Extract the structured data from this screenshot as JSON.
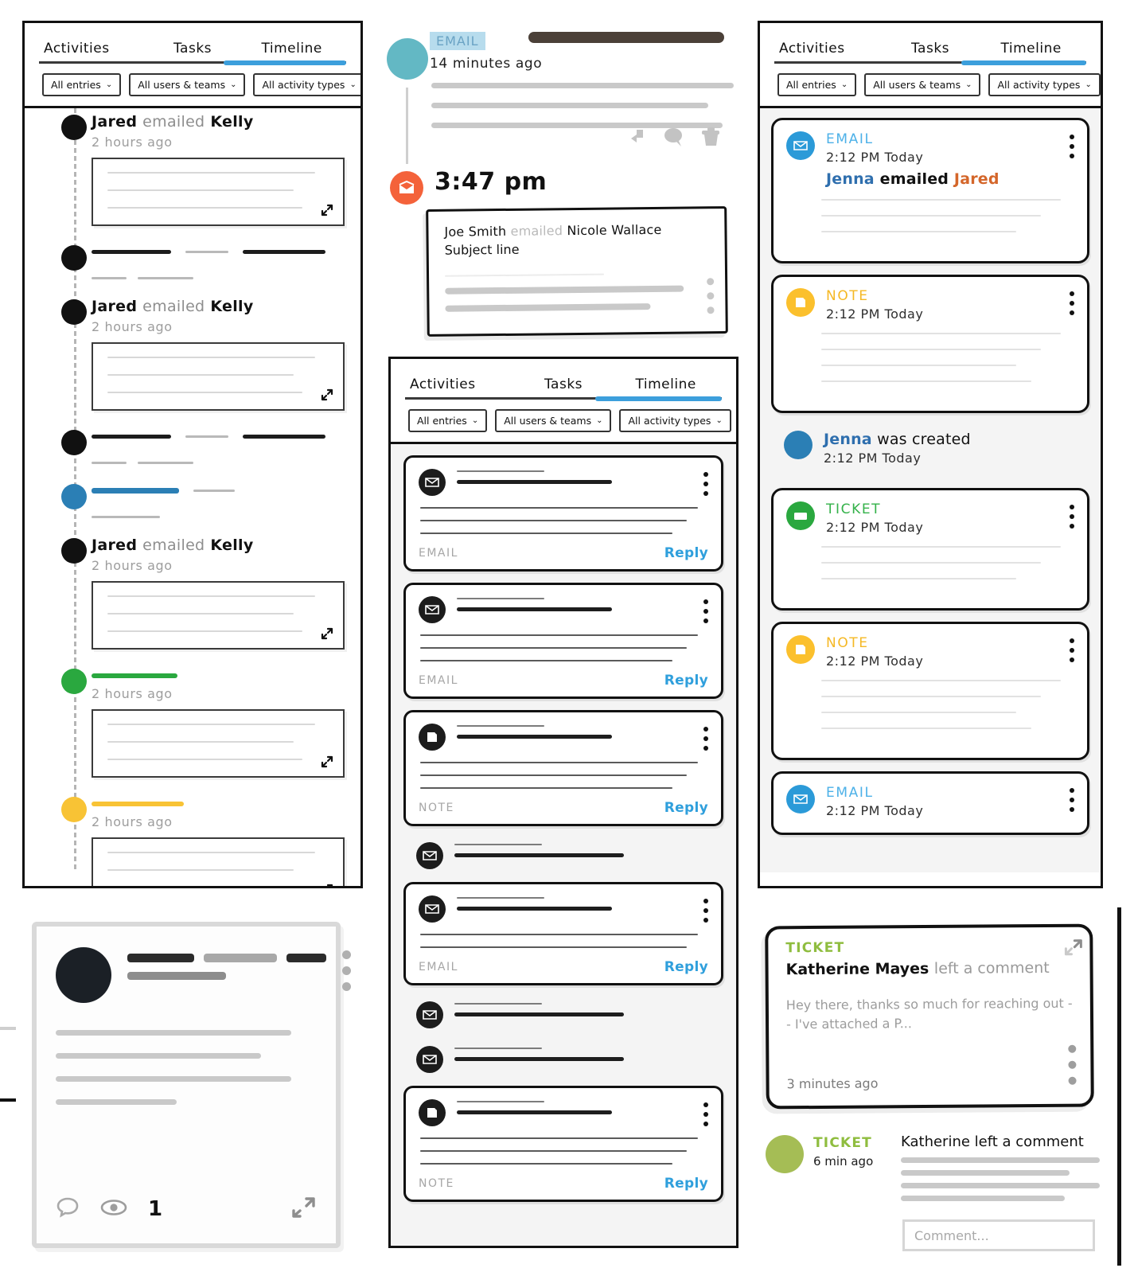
{
  "tabs": {
    "activities": "Activities",
    "tasks": "Tasks",
    "timeline": "Timeline"
  },
  "filters": {
    "entries": "All entries",
    "users": "All users & teams",
    "types": "All activity types",
    "caret": "⌄"
  },
  "left_timeline": {
    "entries": [
      {
        "kind": "titled",
        "dot": "black",
        "actor": "Jared",
        "verb": "emailed",
        "target": "Kelly",
        "time": "2 hours ago",
        "has_panel": true
      },
      {
        "kind": "redacted",
        "dot": "black"
      },
      {
        "kind": "titled",
        "dot": "black",
        "actor": "Jared",
        "verb": "emailed",
        "target": "Kelly",
        "time": "2 hours ago",
        "has_panel": true
      },
      {
        "kind": "redacted",
        "dot": "black"
      },
      {
        "kind": "redacted",
        "dot": "blue"
      },
      {
        "kind": "titled",
        "dot": "black",
        "actor": "Jared",
        "verb": "emailed",
        "target": "Kelly",
        "time": "2 hours ago",
        "has_panel": true
      },
      {
        "kind": "redacted-time",
        "dot": "green",
        "time": "2 hours ago",
        "has_panel": true
      },
      {
        "kind": "redacted-time",
        "dot": "yellow",
        "time": "2 hours ago",
        "has_panel": true
      }
    ]
  },
  "post_card": {
    "view_count": "1",
    "comment_icon": "comment-bubble-icon",
    "views_icon": "eye-icon",
    "expand_icon": "expand-icon"
  },
  "email_detail": {
    "type_label": "EMAIL",
    "time": "14 minutes ago",
    "actions": [
      "reply-arrow-icon",
      "comment-bubble-icon",
      "delete-icon"
    ]
  },
  "time_block": {
    "time": "3:47 pm",
    "avatar_icon": "email-open-icon",
    "card": {
      "actor": "Joe Smith",
      "verb": "emailed",
      "target": "Nicole Wallace",
      "subject": "Subject line"
    }
  },
  "mid_panel": {
    "items": [
      {
        "type": "EMAIL",
        "icon": "envelope-icon",
        "card": true,
        "reply": "Reply",
        "body_lines": 3
      },
      {
        "type": "EMAIL",
        "icon": "envelope-icon",
        "card": true,
        "reply": "Reply",
        "body_lines": 3
      },
      {
        "type": "NOTE",
        "icon": "note-icon",
        "card": true,
        "reply": "Reply",
        "body_lines": 3
      },
      {
        "type": "",
        "icon": "envelope-icon",
        "card": false,
        "reply": "",
        "body_lines": 0
      },
      {
        "type": "EMAIL",
        "icon": "envelope-icon",
        "card": true,
        "reply": "Reply",
        "body_lines": 2
      },
      {
        "type": "",
        "icon": "envelope-icon",
        "card": false,
        "reply": "",
        "body_lines": 0
      },
      {
        "type": "",
        "icon": "envelope-icon",
        "card": false,
        "reply": "",
        "body_lines": 0
      },
      {
        "type": "NOTE",
        "icon": "note-icon",
        "card": true,
        "reply": "Reply",
        "body_lines": 3
      }
    ]
  },
  "right_panel": {
    "items": [
      {
        "type": "EMAIL",
        "icon": "envelope-icon",
        "color": "email",
        "time": "2:12 PM Today",
        "headline": {
          "actor": "Jenna",
          "verb": "emailed",
          "target": "Jared"
        },
        "body_lines": 3,
        "card": true
      },
      {
        "type": "NOTE",
        "icon": "note-icon",
        "color": "note",
        "time": "2:12 PM Today",
        "headline": null,
        "body_lines": 4,
        "card": true
      },
      {
        "type": "",
        "icon": "avatar-icon",
        "color": "plain",
        "time": "2:12 PM Today",
        "created_text": {
          "name": "Jenna",
          "rest": "was created"
        },
        "body_lines": 0,
        "card": false
      },
      {
        "type": "TICKET",
        "icon": "ticket-icon",
        "color": "ticket",
        "time": "2:12 PM Today",
        "headline": null,
        "body_lines": 3,
        "card": true
      },
      {
        "type": "NOTE",
        "icon": "note-icon",
        "color": "note",
        "time": "2:12 PM Today",
        "headline": null,
        "body_lines": 4,
        "card": true
      },
      {
        "type": "EMAIL",
        "icon": "envelope-icon",
        "color": "email",
        "time": "2:12 PM Today",
        "headline": null,
        "body_lines": 0,
        "card": true
      }
    ]
  },
  "ticket_comment": {
    "label": "TICKET",
    "actor": "Katherine Mayes",
    "action": "left a comment",
    "body": "Hey there, thanks so much for reaching out -- I've attached a P...",
    "time": "3 minutes ago",
    "expand_icon": "expand-icon"
  },
  "comment_row": {
    "label": "TICKET",
    "time": "6 min ago",
    "text": "Katherine left a comment",
    "input_placeholder": "Comment..."
  },
  "colors": {
    "accent_blue": "#2f9fdc",
    "email": "#2b9ad8",
    "note": "#fbc02d",
    "ticket": "#2aa83f",
    "ticket_olive": "#8fbd3f",
    "orange": "#f4623a",
    "teal": "#63b8c4"
  }
}
